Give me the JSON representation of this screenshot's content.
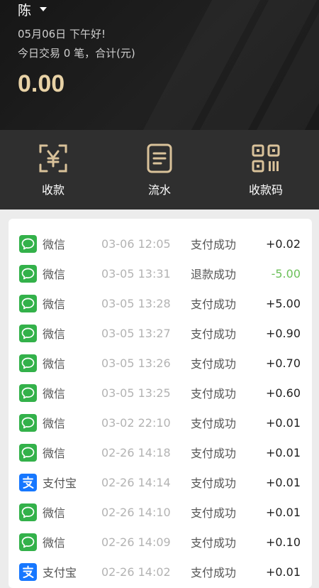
{
  "header": {
    "user_name": "陈",
    "greeting": "05月06日 下午好!",
    "summary": "今日交易 0 笔，合计(元)",
    "total": "0.00"
  },
  "actions": [
    {
      "label": "收款",
      "icon": "yuan-scan-icon"
    },
    {
      "label": "流水",
      "icon": "document-icon"
    },
    {
      "label": "收款码",
      "icon": "qr-code-icon"
    }
  ],
  "colors": {
    "accent_gold": "#e8d2a6",
    "wechat_green": "#33b14a",
    "alipay_blue": "#1677ff",
    "refund_green": "#6cc05a"
  },
  "transactions": [
    {
      "channel": "微信",
      "type": "wechat",
      "time": "03-06 12:05",
      "status": "支付成功",
      "amount": "+0.02"
    },
    {
      "channel": "微信",
      "type": "wechat",
      "time": "03-05 13:31",
      "status": "退款成功",
      "amount": "-5.00"
    },
    {
      "channel": "微信",
      "type": "wechat",
      "time": "03-05 13:28",
      "status": "支付成功",
      "amount": "+5.00"
    },
    {
      "channel": "微信",
      "type": "wechat",
      "time": "03-05 13:27",
      "status": "支付成功",
      "amount": "+0.90"
    },
    {
      "channel": "微信",
      "type": "wechat",
      "time": "03-05 13:26",
      "status": "支付成功",
      "amount": "+0.70"
    },
    {
      "channel": "微信",
      "type": "wechat",
      "time": "03-05 13:25",
      "status": "支付成功",
      "amount": "+0.60"
    },
    {
      "channel": "微信",
      "type": "wechat",
      "time": "03-02 22:10",
      "status": "支付成功",
      "amount": "+0.01"
    },
    {
      "channel": "微信",
      "type": "wechat",
      "time": "02-26 14:18",
      "status": "支付成功",
      "amount": "+0.01"
    },
    {
      "channel": "支付宝",
      "type": "alipay",
      "time": "02-26 14:14",
      "status": "支付成功",
      "amount": "+0.01"
    },
    {
      "channel": "微信",
      "type": "wechat",
      "time": "02-26 14:10",
      "status": "支付成功",
      "amount": "+0.01"
    },
    {
      "channel": "微信",
      "type": "wechat",
      "time": "02-26 14:09",
      "status": "支付成功",
      "amount": "+0.10"
    },
    {
      "channel": "支付宝",
      "type": "alipay",
      "time": "02-26 14:02",
      "status": "支付成功",
      "amount": "+0.01"
    }
  ]
}
